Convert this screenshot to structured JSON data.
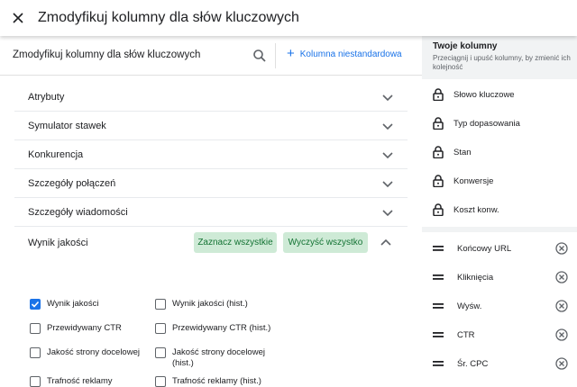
{
  "window": {
    "title": "Zmodyfikuj kolumny dla słów kluczowych"
  },
  "subbar": {
    "title": "Zmodyfikuj kolumny dla słów kluczowych",
    "custom_column": "Kolumna niestandardowa"
  },
  "sections": [
    {
      "label": "Atrybuty"
    },
    {
      "label": "Symulator stawek"
    },
    {
      "label": "Konkurencja"
    },
    {
      "label": "Szczegóły połączeń"
    },
    {
      "label": "Szczegóły wiadomości"
    }
  ],
  "open_section": {
    "label": "Wynik jakości",
    "select_all": "Zaznacz wszystkie",
    "clear_all": "Wyczyść wszystko",
    "options": [
      {
        "label": "Wynik jakości",
        "checked": true
      },
      {
        "label": "Wynik jakości (hist.)",
        "checked": false
      },
      {
        "label": "Przewidywany CTR",
        "checked": false
      },
      {
        "label": "Przewidywany CTR (hist.)",
        "checked": false
      },
      {
        "label": "Jakość strony docelowej",
        "checked": false
      },
      {
        "label": "Jakość strony docelowej (hist.)",
        "checked": false
      },
      {
        "label": "Trafność reklamy",
        "checked": false
      },
      {
        "label": "Trafność reklamy (hist.)",
        "checked": false
      }
    ]
  },
  "your_columns": {
    "title": "Twoje kolumny",
    "subtitle": "Przeciągnij i upuść kolumny, by zmienić ich kolejność",
    "locked": [
      "Słowo kluczowe",
      "Typ dopasowania",
      "Stan",
      "Konwersje",
      "Koszt konw."
    ],
    "movable": [
      "Końcowy URL",
      "Kliknięcia",
      "Wyśw.",
      "CTR",
      "Śr. CPC"
    ]
  },
  "colors": {
    "accent": "#1a73e8",
    "chip_bg": "#ceead6",
    "chip_text": "#137333",
    "panel_bg": "#f1f3f4"
  }
}
